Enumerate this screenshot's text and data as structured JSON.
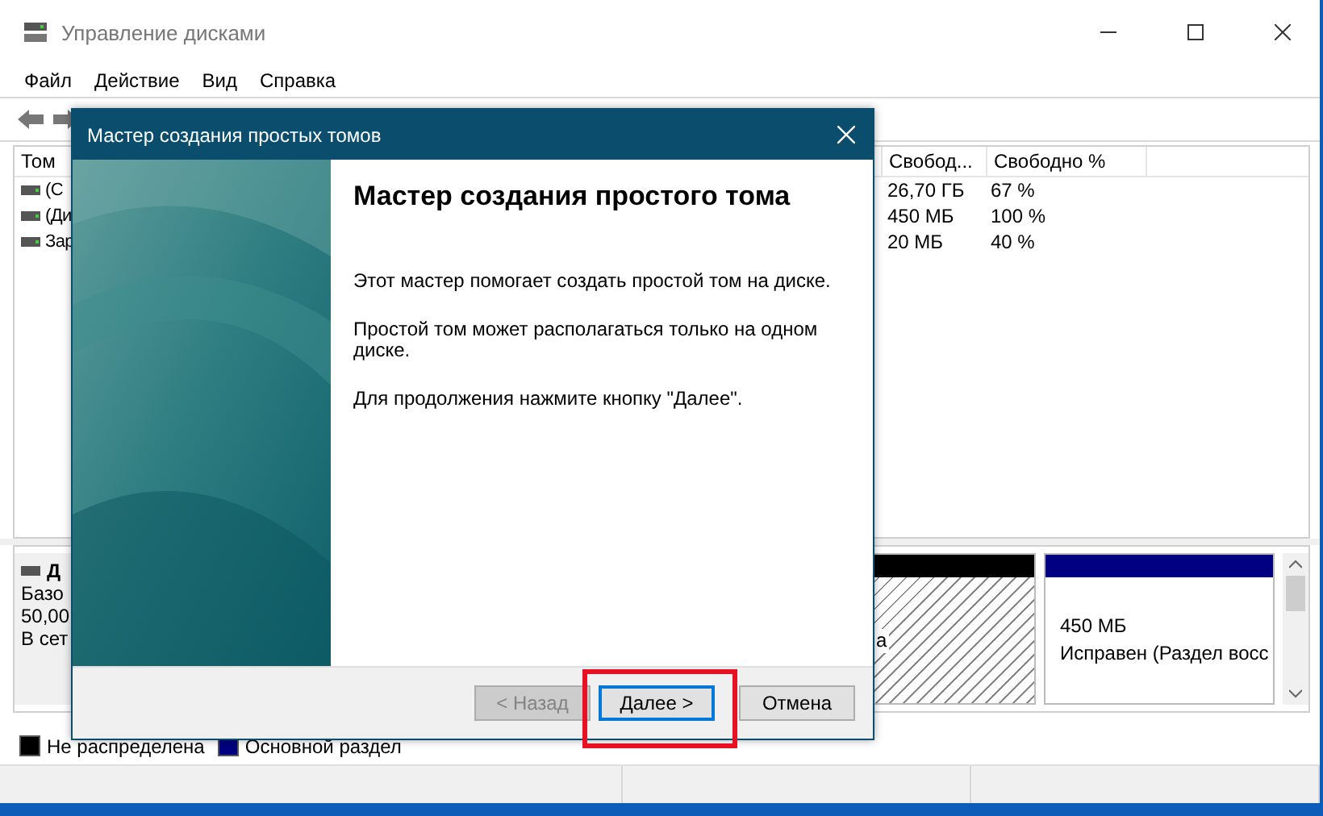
{
  "window": {
    "title": "Управление дисками"
  },
  "menu": [
    {
      "label": "Файл"
    },
    {
      "label": "Действие"
    },
    {
      "label": "Вид"
    },
    {
      "label": "Справка"
    }
  ],
  "volume_table": {
    "columns": [
      {
        "label": "Том"
      },
      {
        "label": "Свобод..."
      },
      {
        "label": "Свободно %"
      }
    ],
    "rows": [
      {
        "volume": "(С",
        "free": "26,70 ГБ",
        "free_percent": "67 %"
      },
      {
        "volume": "(Ди",
        "free": "450 МБ",
        "free_percent": "100 %"
      },
      {
        "volume": "Зар",
        "free": "20 МБ",
        "free_percent": "40 %"
      }
    ]
  },
  "disk": {
    "name": "Д",
    "type": "Базо",
    "size": "50,00",
    "status": "В сет"
  },
  "partitions": [
    {
      "kind": "unallocated",
      "lines": [
        "а"
      ]
    },
    {
      "kind": "primary",
      "lines": [
        "450 МБ",
        "Исправен (Раздел восс"
      ]
    }
  ],
  "legend": [
    {
      "label": "Не распределена",
      "color": "#000000"
    },
    {
      "label": "Основной раздел",
      "color": "#000080"
    }
  ],
  "dialog": {
    "title": "Мастер создания простых томов",
    "heading": "Мастер создания простого тома",
    "paragraphs": [
      "Этот мастер помогает создать простой том на диске.",
      "Простой том может располагаться только на одном диске.",
      "Для продолжения нажмите кнопку \"Далее\"."
    ],
    "buttons": [
      {
        "label": "< Назад",
        "disabled": true,
        "focused": false
      },
      {
        "label": "Далее >",
        "disabled": false,
        "focused": true
      },
      {
        "label": "Отмена",
        "disabled": false,
        "focused": false
      }
    ]
  },
  "annotation": {
    "kind": "frame"
  }
}
